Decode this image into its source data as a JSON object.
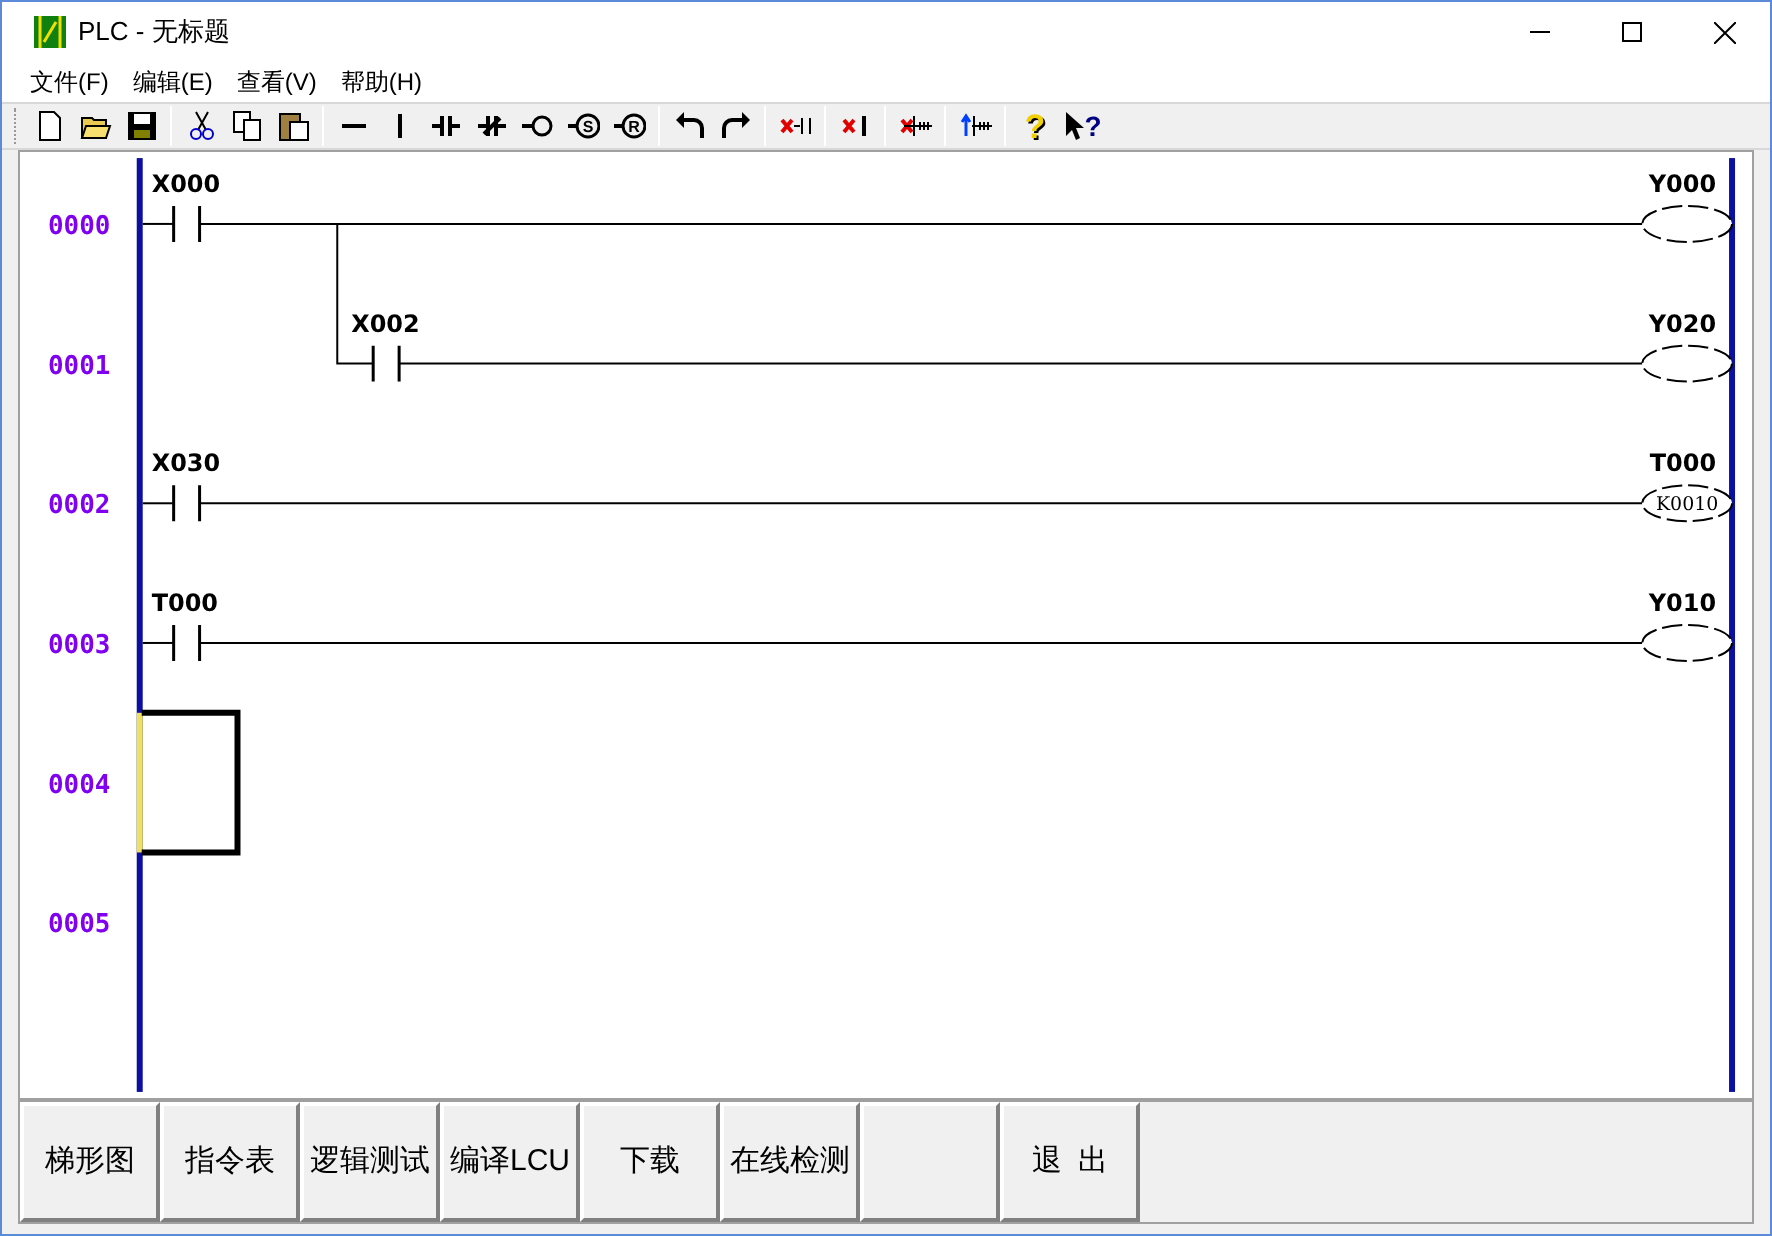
{
  "window": {
    "title": "PLC - 无标题"
  },
  "menu": [
    {
      "label": "文件(F)"
    },
    {
      "label": "编辑(E)"
    },
    {
      "label": "查看(V)"
    },
    {
      "label": "帮助(H)"
    }
  ],
  "toolbar": {
    "set_coil_glyph": "S",
    "reset_coil_glyph": "R",
    "help_glyph": "?",
    "context_help_glyph": "?"
  },
  "rungs": [
    {
      "number": "0000",
      "kind": "contact",
      "contact": "X000",
      "coil": "Y000",
      "selected": false
    },
    {
      "number": "0001",
      "kind": "branch",
      "contact": "X002",
      "coil": "Y020",
      "selected": false
    },
    {
      "number": "0002",
      "kind": "contact",
      "contact": "X030",
      "coil": "T000",
      "setting": "K0010",
      "selected": false
    },
    {
      "number": "0003",
      "kind": "contact",
      "contact": "T000",
      "coil": "Y010",
      "selected": false
    },
    {
      "number": "0004",
      "kind": "empty",
      "selected": true
    },
    {
      "number": "0005",
      "kind": "empty",
      "selected": false
    }
  ],
  "buttons": [
    {
      "kind": "text",
      "label": "梯形图"
    },
    {
      "kind": "text",
      "label": "指令表"
    },
    {
      "kind": "text",
      "label": "逻辑测试"
    },
    {
      "kind": "text",
      "label": "编译LCU"
    },
    {
      "kind": "text",
      "label": "下载"
    },
    {
      "kind": "text",
      "label": "在线检测"
    },
    {
      "kind": "blank"
    },
    {
      "kind": "text",
      "label": "退  出"
    }
  ]
}
